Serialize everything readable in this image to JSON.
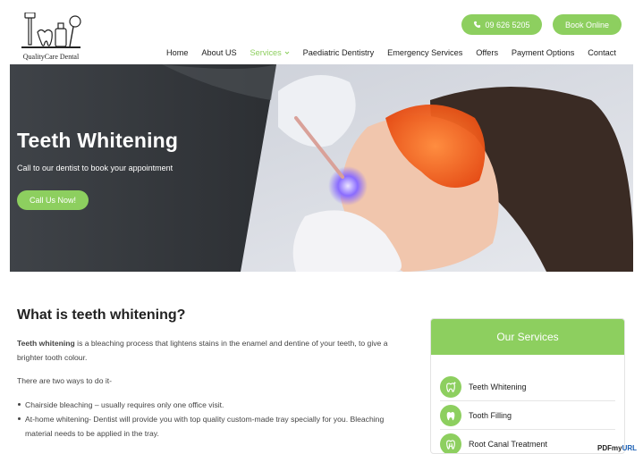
{
  "brand": {
    "name": "QualityCare Dental",
    "accent": "#8dcf5f"
  },
  "header": {
    "phone_label": "09 626 5205",
    "book_label": "Book Online",
    "nav": [
      {
        "label": "Home"
      },
      {
        "label": "About US"
      },
      {
        "label": "Services",
        "active": true
      },
      {
        "label": "Paediatric Dentistry"
      },
      {
        "label": "Emergency Services"
      },
      {
        "label": "Offers"
      },
      {
        "label": "Payment Options"
      },
      {
        "label": "Contact"
      }
    ]
  },
  "hero": {
    "title": "Teeth Whitening",
    "subtitle": "Call to our dentist to book your appointment",
    "cta_label": "Call Us Now!"
  },
  "content": {
    "heading": "What is teeth whitening?",
    "p1_bold": "Teeth whitening",
    "p1_rest": " is a bleaching process that lightens stains in the enamel and dentine of your teeth, to give a brighter tooth colour.",
    "p2": "There are two ways to do it-",
    "bullets": [
      "Chairside bleaching – usually requires only one office visit.",
      "At-home whitening- Dentist will provide you with top quality custom-made tray specially for you. Bleaching material needs to be applied in the tray."
    ]
  },
  "sidebar": {
    "title": "Our Services",
    "items": [
      {
        "label": "Teeth Whitening",
        "icon": "tooth-sparkle-icon"
      },
      {
        "label": "Tooth Filling",
        "icon": "tooth-icon"
      },
      {
        "label": "Root Canal Treatment",
        "icon": "root-canal-icon"
      }
    ]
  },
  "watermark": {
    "prefix": "PDFmy",
    "suffix": "URL"
  }
}
